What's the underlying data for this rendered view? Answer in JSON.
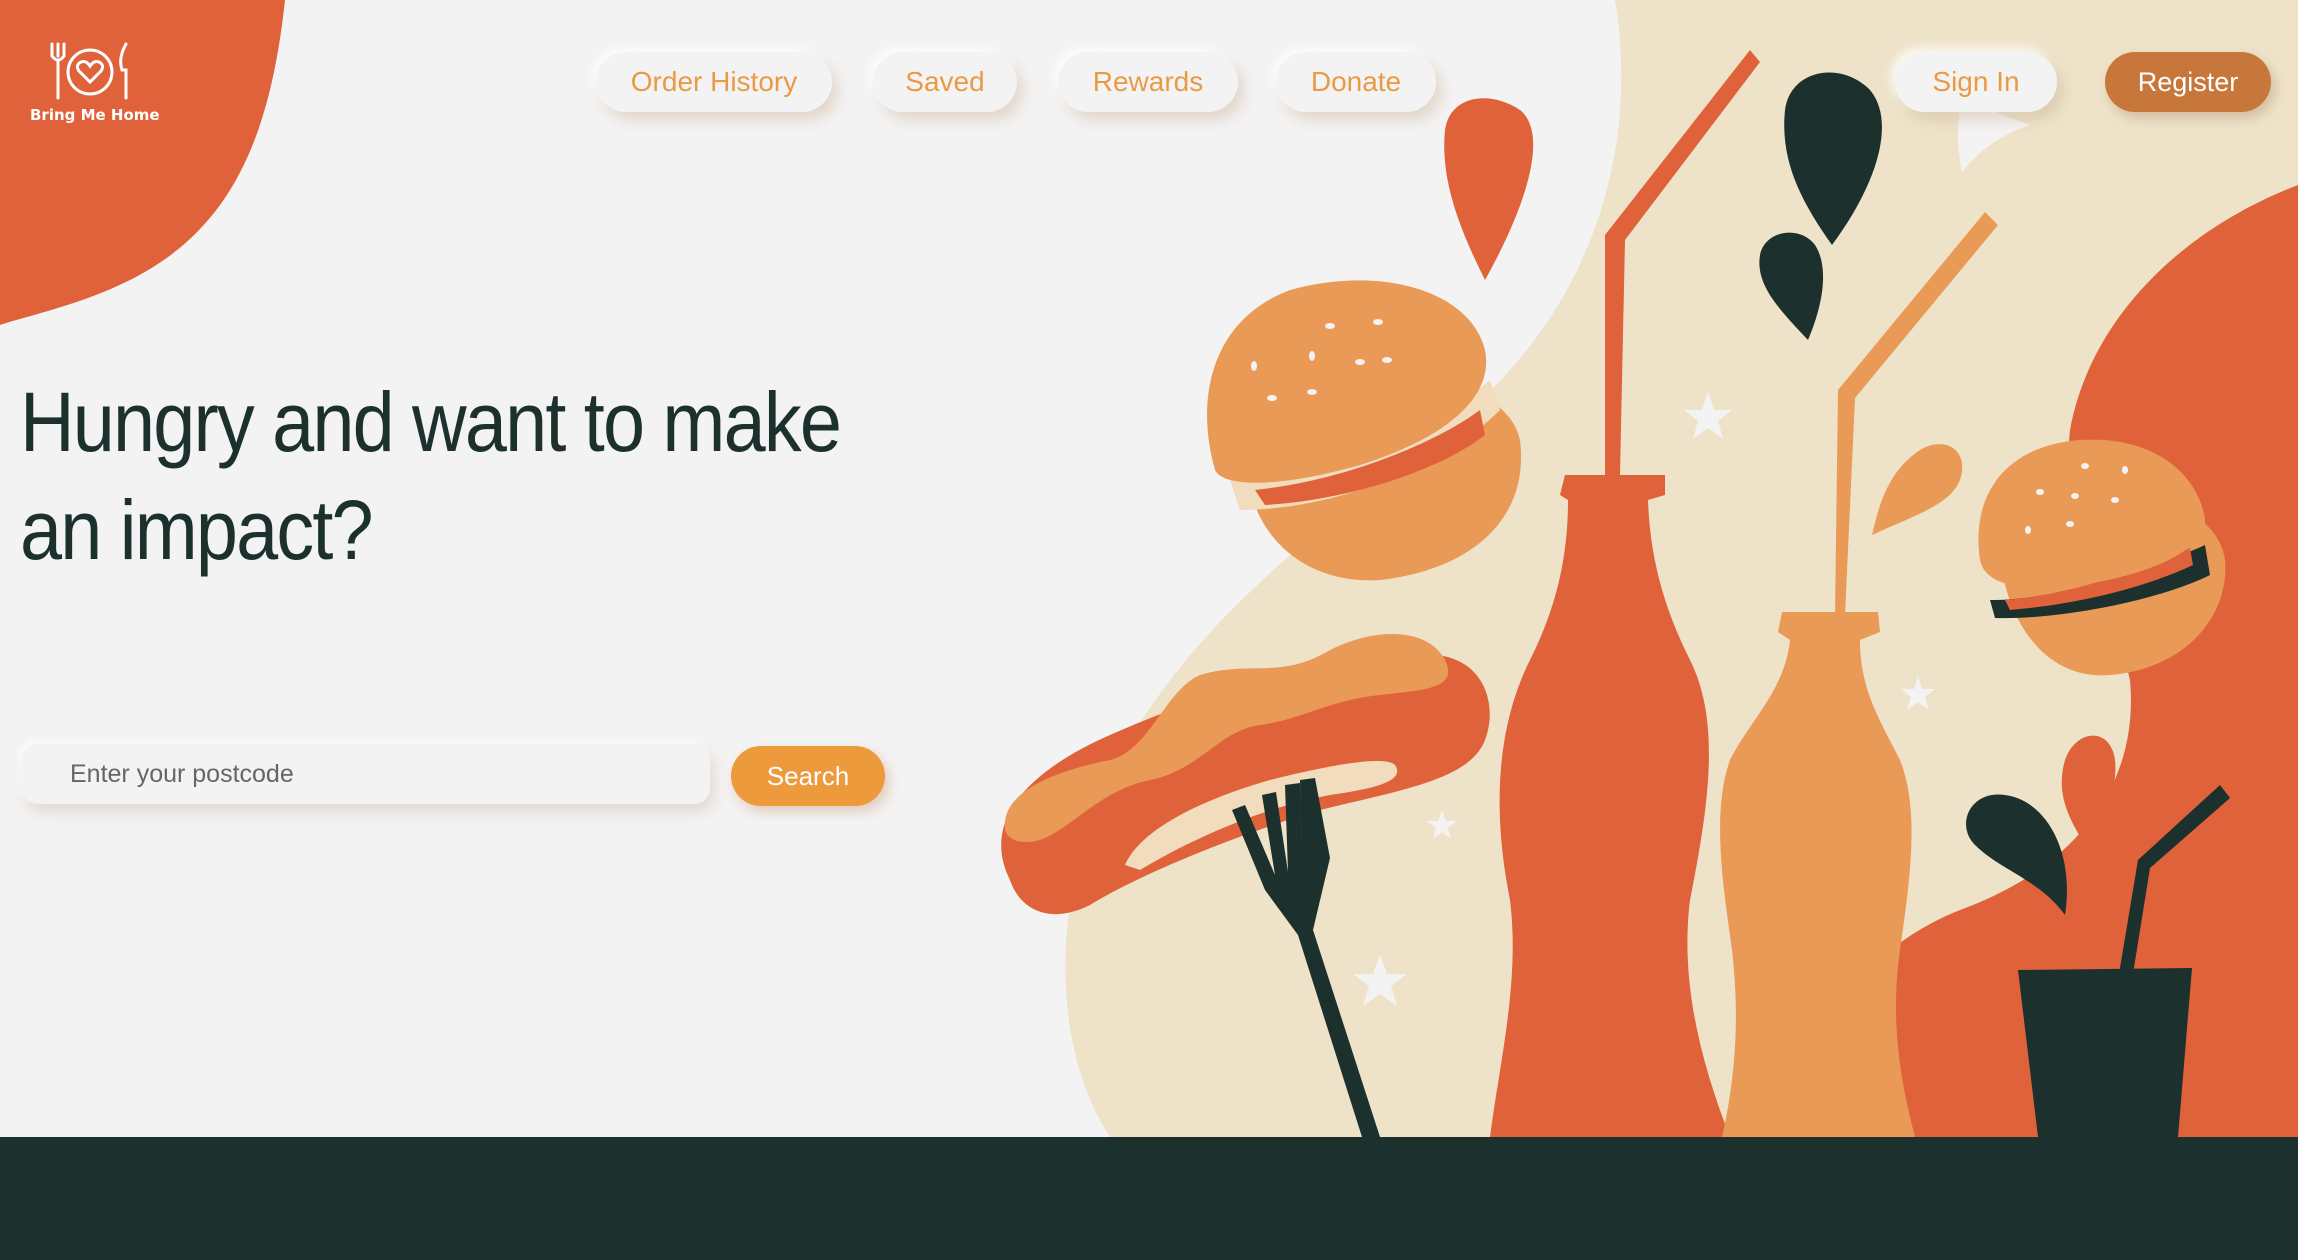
{
  "brand": {
    "name": "Bring Me Home",
    "logo_icon": "plate-heart-cutlery-icon"
  },
  "nav": {
    "order_history": "Order History",
    "saved": "Saved",
    "rewards": "Rewards",
    "donate": "Donate",
    "sign_in": "Sign In",
    "register": "Register"
  },
  "hero": {
    "headline": "Hungry and want to make an impact?",
    "search_placeholder": "Enter your postcode",
    "search_value": "",
    "search_button": "Search"
  },
  "illustration": {
    "items": [
      "burger-icon",
      "burger-icon",
      "hot-dog-icon",
      "fork-icon",
      "bottle-icon",
      "bottle-icon",
      "cup-with-straw-icon",
      "sauce-drop-icon",
      "star-icon"
    ]
  },
  "colors": {
    "primary_orange": "#df623a",
    "light_orange": "#ea9a57",
    "accent": "#ec9a3c",
    "register": "#c8773a",
    "dark": "#1c302e",
    "cream": "#eee3c9",
    "background": "#f4f3f3"
  }
}
